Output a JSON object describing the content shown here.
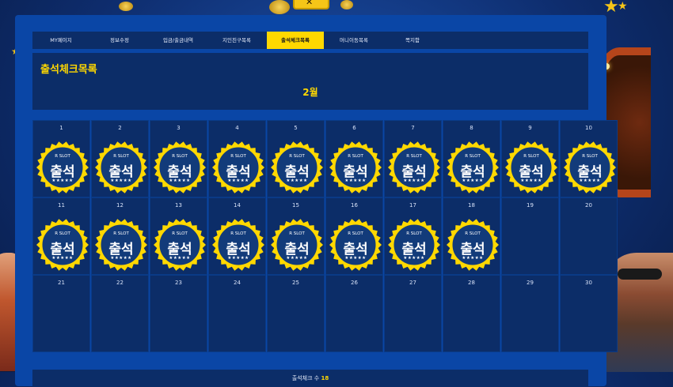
{
  "tabs": [
    {
      "label": "MY페이지",
      "active": false
    },
    {
      "label": "정보수정",
      "active": false
    },
    {
      "label": "입금/출금내역",
      "active": false
    },
    {
      "label": "지인친구목록",
      "active": false
    },
    {
      "label": "출석체크목록",
      "active": true
    },
    {
      "label": "머니이동목록",
      "active": false
    },
    {
      "label": "쪽지함",
      "active": false
    }
  ],
  "header": {
    "title": "출석체크목록",
    "month": "2월"
  },
  "stamp": {
    "brand": "R SLOT",
    "text": "출석",
    "stars": "★★★★★"
  },
  "days": [
    {
      "num": "1",
      "checked": true
    },
    {
      "num": "2",
      "checked": true
    },
    {
      "num": "3",
      "checked": true
    },
    {
      "num": "4",
      "checked": true
    },
    {
      "num": "5",
      "checked": true
    },
    {
      "num": "6",
      "checked": true
    },
    {
      "num": "7",
      "checked": true
    },
    {
      "num": "8",
      "checked": true
    },
    {
      "num": "9",
      "checked": true
    },
    {
      "num": "10",
      "checked": true
    },
    {
      "num": "11",
      "checked": true
    },
    {
      "num": "12",
      "checked": true
    },
    {
      "num": "13",
      "checked": true
    },
    {
      "num": "14",
      "checked": true
    },
    {
      "num": "15",
      "checked": true
    },
    {
      "num": "16",
      "checked": true
    },
    {
      "num": "17",
      "checked": true
    },
    {
      "num": "18",
      "checked": true
    },
    {
      "num": "19",
      "checked": false
    },
    {
      "num": "20",
      "checked": false
    },
    {
      "num": "21",
      "checked": false
    },
    {
      "num": "22",
      "checked": false
    },
    {
      "num": "23",
      "checked": false
    },
    {
      "num": "24",
      "checked": false
    },
    {
      "num": "25",
      "checked": false
    },
    {
      "num": "26",
      "checked": false
    },
    {
      "num": "27",
      "checked": false
    },
    {
      "num": "28",
      "checked": false
    },
    {
      "num": "29",
      "checked": false
    },
    {
      "num": "30",
      "checked": false
    }
  ],
  "footer": {
    "label": "출석체크 수",
    "count": "18"
  },
  "colors": {
    "accent": "#ffd800",
    "panel": "#0a46a6",
    "cell": "#0c2d68",
    "stamp_fill": "#123b7a"
  }
}
